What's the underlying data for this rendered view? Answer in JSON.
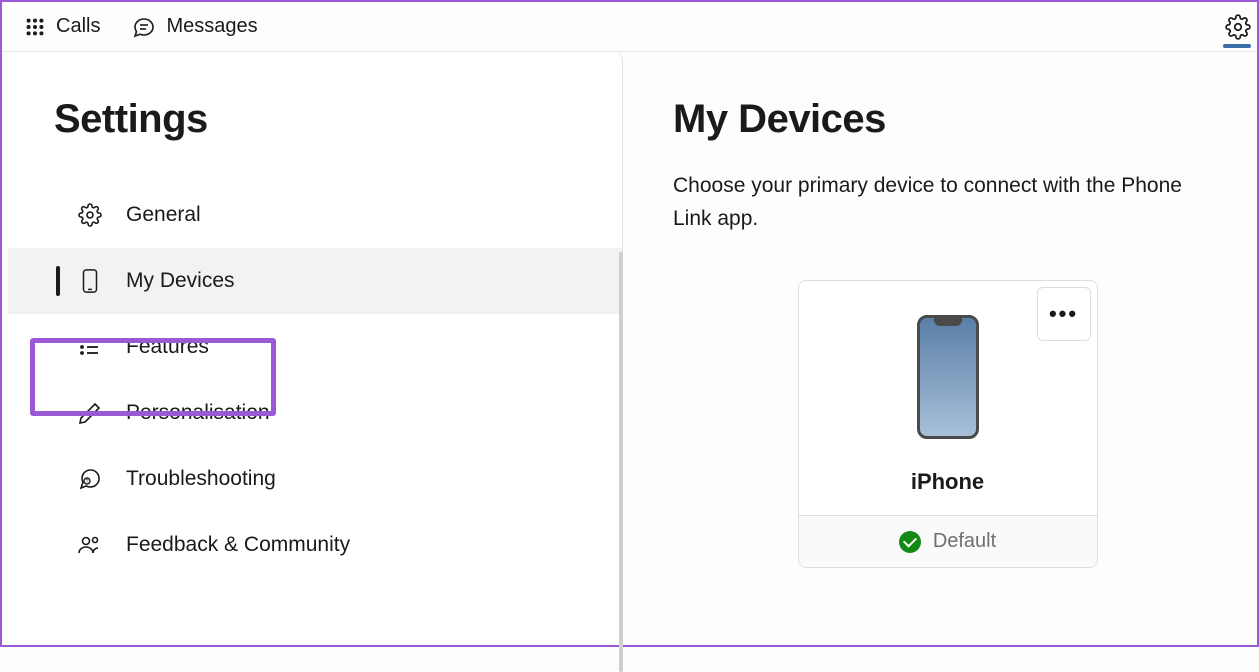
{
  "topBar": {
    "calls": "Calls",
    "messages": "Messages"
  },
  "sidebar": {
    "title": "Settings",
    "items": [
      {
        "label": "General"
      },
      {
        "label": "My Devices"
      },
      {
        "label": "Features"
      },
      {
        "label": "Personalisation"
      },
      {
        "label": "Troubleshooting"
      },
      {
        "label": "Feedback & Community"
      }
    ]
  },
  "content": {
    "title": "My Devices",
    "subtitle": "Choose your primary device to connect with the Phone Link app.",
    "device": {
      "name": "iPhone",
      "status": "Default"
    }
  }
}
